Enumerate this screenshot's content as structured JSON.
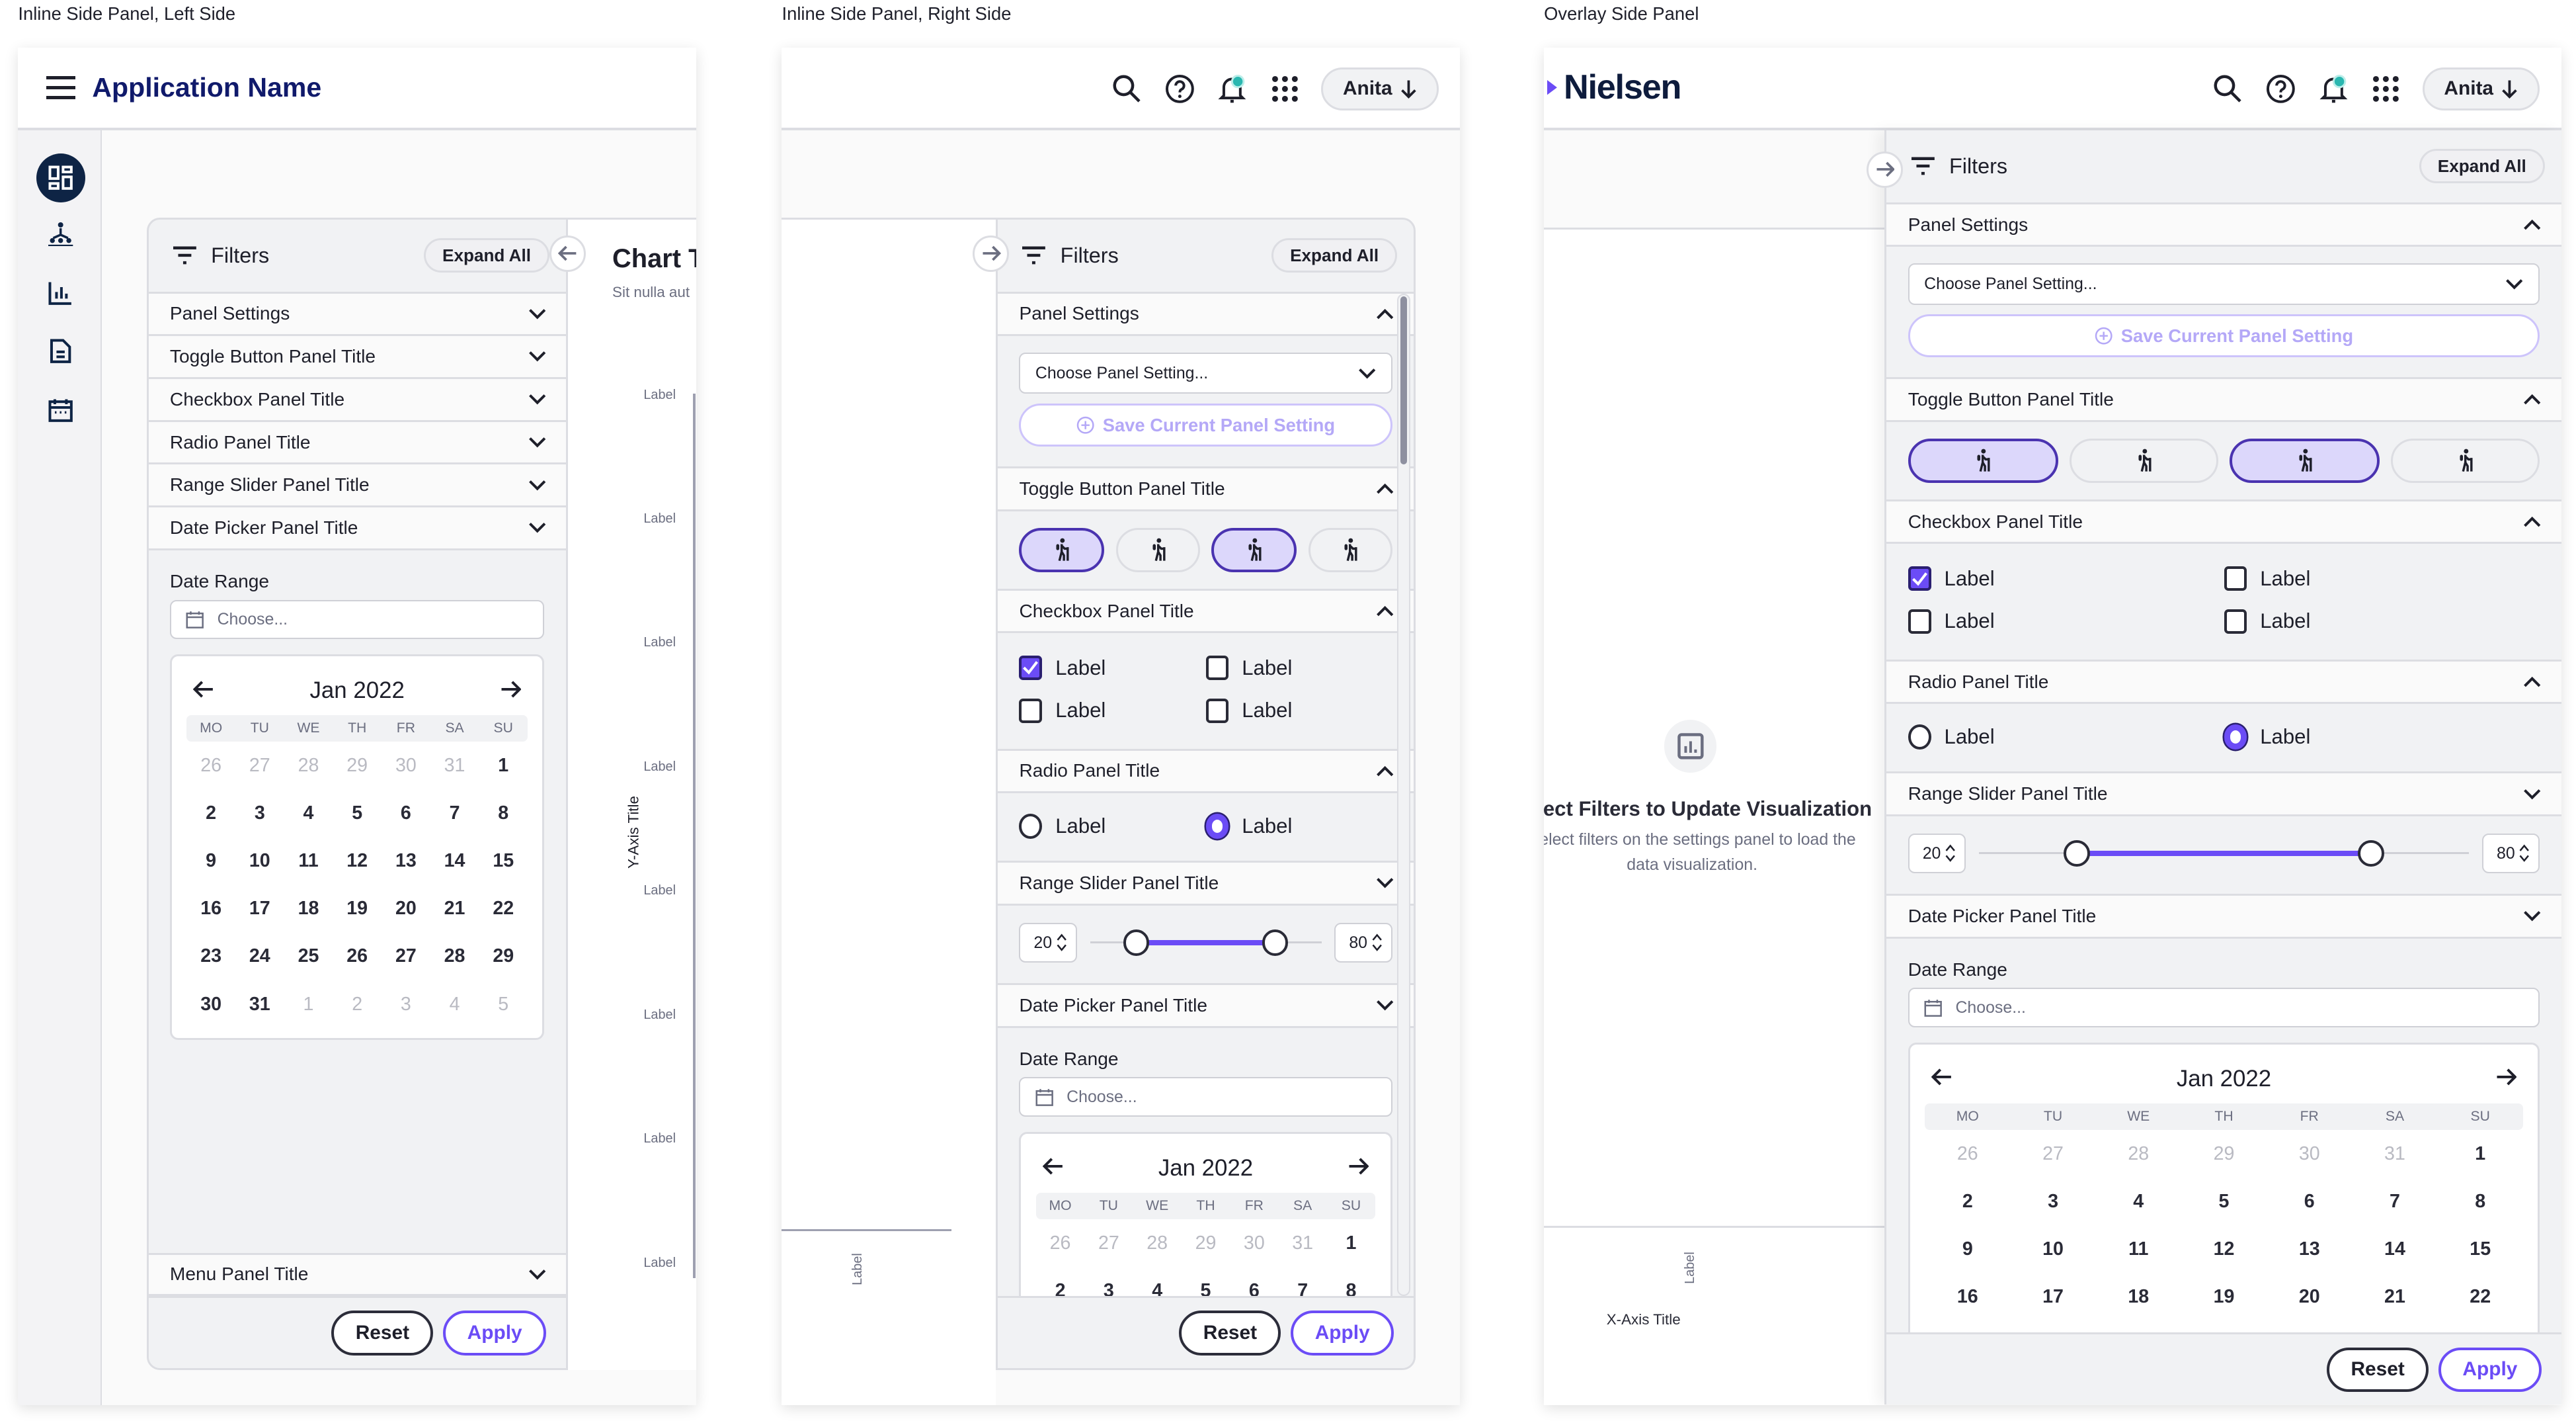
{
  "captions": [
    "Inline Side Panel, Left Side",
    "Inline Side Panel, Right Side",
    "Overlay Side Panel"
  ],
  "colors": {
    "accent": "#6b4cf6",
    "navy": "#0e2445",
    "toggle_selected": "#dcd7fb",
    "notification": "#2ab7b0"
  },
  "frame1": {
    "app_name": "Application Name",
    "rail": [
      {
        "icon": "dashboard-icon",
        "active": true
      },
      {
        "icon": "hierarchy-icon",
        "active": false
      },
      {
        "icon": "bar-chart-icon",
        "active": false
      },
      {
        "icon": "document-icon",
        "active": false
      },
      {
        "icon": "calendar-icon",
        "active": false
      }
    ],
    "chart": {
      "title": "Chart T",
      "subtitle": "Sit nulla aut",
      "y_axis_title": "Y-Axis Title",
      "y_labels": [
        "Label",
        "Label",
        "Label",
        "Label",
        "Label",
        "Label",
        "Label",
        "Label"
      ]
    },
    "panel": {
      "title": "Filters",
      "expand_label": "Expand All",
      "reset_label": "Reset",
      "apply_label": "Apply",
      "sections": [
        {
          "title": "Panel Settings",
          "chevron": "down"
        },
        {
          "title": "Toggle Button Panel Title",
          "chevron": "down"
        },
        {
          "title": "Checkbox Panel Title",
          "chevron": "down"
        },
        {
          "title": "Radio Panel Title",
          "chevron": "down"
        },
        {
          "title": "Range Slider Panel Title",
          "chevron": "down"
        },
        {
          "title": "Date Picker Panel Title",
          "chevron": "down",
          "content": {
            "type": "date"
          }
        }
      ],
      "bottom_sections": [
        {
          "title": "Menu Panel Title",
          "chevron": "down"
        }
      ]
    }
  },
  "frame2": {
    "user": "Anita",
    "x_label": "Label",
    "panel": {
      "title": "Filters",
      "expand_label": "Expand All",
      "reset_label": "Reset",
      "apply_label": "Apply",
      "scrollbar": true,
      "sections": [
        {
          "title": "Panel Settings",
          "chevron": "up",
          "content": {
            "type": "select"
          }
        },
        {
          "title": "Toggle Button Panel Title",
          "chevron": "up",
          "content": {
            "type": "toggles",
            "selected": [
              true,
              false,
              true,
              false
            ]
          }
        },
        {
          "title": "Checkbox Panel Title",
          "chevron": "up",
          "content": {
            "type": "checkbox",
            "items": [
              {
                "label": "Label",
                "checked": true
              },
              {
                "label": "Label",
                "checked": false
              },
              {
                "label": "Label",
                "checked": false
              },
              {
                "label": "Label",
                "checked": false
              }
            ]
          }
        },
        {
          "title": "Radio Panel Title",
          "chevron": "up",
          "content": {
            "type": "radio",
            "items": [
              {
                "label": "Label",
                "selected": false
              },
              {
                "label": "Label",
                "selected": true
              }
            ]
          }
        },
        {
          "title": "Range Slider Panel Title",
          "chevron": "down",
          "content": {
            "type": "range",
            "min": 20,
            "max": 80
          }
        },
        {
          "title": "Date Picker Panel Title",
          "chevron": "down",
          "content": {
            "type": "date"
          }
        }
      ]
    }
  },
  "frame3": {
    "brand": "Nielsen",
    "user": "Anita",
    "empty_state": {
      "title": "Select Filters to Update Visualization",
      "line1": "Select filters on the settings panel to load the",
      "line2": "data visualization."
    },
    "x_label": "Label",
    "x_axis_title": "X-Axis Title",
    "panel": {
      "title": "Filters",
      "expand_label": "Expand All",
      "reset_label": "Reset",
      "apply_label": "Apply",
      "sections": [
        {
          "title": "Panel Settings",
          "chevron": "up",
          "content": {
            "type": "select"
          }
        },
        {
          "title": "Toggle Button Panel Title",
          "chevron": "up",
          "content": {
            "type": "toggles",
            "selected": [
              true,
              false,
              true,
              false
            ]
          }
        },
        {
          "title": "Checkbox Panel Title",
          "chevron": "up",
          "content": {
            "type": "checkbox",
            "items": [
              {
                "label": "Label",
                "checked": true
              },
              {
                "label": "Label",
                "checked": false
              },
              {
                "label": "Label",
                "checked": false
              },
              {
                "label": "Label",
                "checked": false
              }
            ]
          }
        },
        {
          "title": "Radio Panel Title",
          "chevron": "up",
          "content": {
            "type": "radio",
            "items": [
              {
                "label": "Label",
                "selected": false
              },
              {
                "label": "Label",
                "selected": true
              }
            ]
          }
        },
        {
          "title": "Range Slider Panel Title",
          "chevron": "down",
          "content": {
            "type": "range",
            "min": 20,
            "max": 80
          }
        },
        {
          "title": "Date Picker Panel Title",
          "chevron": "down",
          "content": {
            "type": "date"
          }
        }
      ]
    }
  },
  "panel_settings": {
    "select_placeholder": "Choose Panel Setting...",
    "save_label": "Save Current Panel Setting"
  },
  "date_picker": {
    "label": "Date Range",
    "placeholder": "Choose...",
    "month": "Jan 2022",
    "weekdays": [
      "MO",
      "TU",
      "WE",
      "TH",
      "FR",
      "SA",
      "SU"
    ],
    "weeks": [
      [
        {
          "d": "26",
          "m": true
        },
        {
          "d": "27",
          "m": true
        },
        {
          "d": "28",
          "m": true
        },
        {
          "d": "29",
          "m": true
        },
        {
          "d": "30",
          "m": true
        },
        {
          "d": "31",
          "m": true
        },
        {
          "d": "1"
        }
      ],
      [
        {
          "d": "2"
        },
        {
          "d": "3"
        },
        {
          "d": "4"
        },
        {
          "d": "5"
        },
        {
          "d": "6"
        },
        {
          "d": "7"
        },
        {
          "d": "8"
        }
      ],
      [
        {
          "d": "9"
        },
        {
          "d": "10"
        },
        {
          "d": "11"
        },
        {
          "d": "12"
        },
        {
          "d": "13"
        },
        {
          "d": "14"
        },
        {
          "d": "15"
        }
      ],
      [
        {
          "d": "16"
        },
        {
          "d": "17"
        },
        {
          "d": "18"
        },
        {
          "d": "19"
        },
        {
          "d": "20"
        },
        {
          "d": "21"
        },
        {
          "d": "22"
        }
      ],
      [
        {
          "d": "23"
        },
        {
          "d": "24"
        },
        {
          "d": "25"
        },
        {
          "d": "26"
        },
        {
          "d": "27"
        },
        {
          "d": "28"
        },
        {
          "d": "29"
        }
      ],
      [
        {
          "d": "30"
        },
        {
          "d": "31"
        },
        {
          "d": "1",
          "m": true
        },
        {
          "d": "2",
          "m": true
        },
        {
          "d": "3",
          "m": true
        },
        {
          "d": "4",
          "m": true
        },
        {
          "d": "5",
          "m": true
        }
      ]
    ]
  }
}
